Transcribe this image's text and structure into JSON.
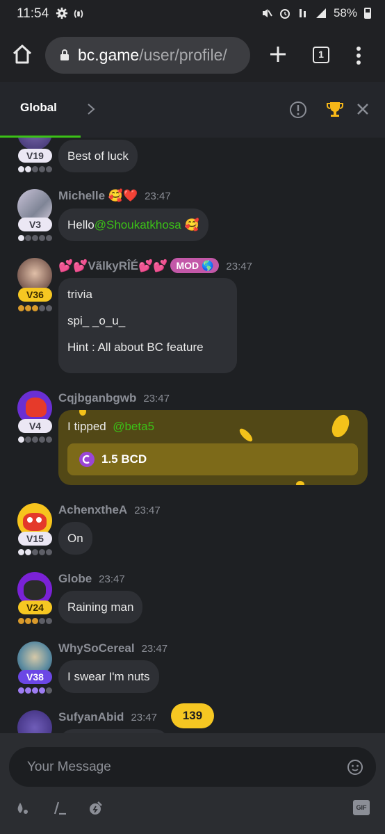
{
  "status_bar": {
    "time": "11:54",
    "battery": "58%",
    "icons": [
      "gear-icon",
      "nfc-icon",
      "mute-icon",
      "alarm-icon",
      "wifi-calling-icon",
      "signal-icon",
      "battery-icon"
    ]
  },
  "browser": {
    "url_host": "bc.game",
    "url_path": "/user/profile/",
    "tab_count": "1"
  },
  "chat_header": {
    "tab_label": "Global"
  },
  "messages": [
    {
      "user": "",
      "level": "V19",
      "text": "Best of luck"
    },
    {
      "user": "Michelle 🥰❤️",
      "time": "23:47",
      "level": "V3",
      "text_prefix": "Hello",
      "mention": "@Shoukatkhosa",
      "text_suffix": " 🥰"
    },
    {
      "user": "💕💕VãlkyRÎÉ💕💕",
      "mod_badge": "MOD 🌎",
      "time": "23:47",
      "level": "V36",
      "lines": [
        "trivia",
        "spi_ _o_u_",
        "Hint : All about BC feature"
      ]
    },
    {
      "user": "Cqjbganbgwb",
      "time": "23:47",
      "level": "V4",
      "tip_prefix": "I tipped",
      "tip_mention": "@beta5",
      "tip_amount": "1.5 BCD"
    },
    {
      "user": "AchenxtheA",
      "time": "23:47",
      "level": "V15",
      "text": "On"
    },
    {
      "user": "Globe",
      "time": "23:47",
      "level": "V24",
      "text": "Raining man"
    },
    {
      "user": "WhySoCereal",
      "time": "23:47",
      "level": "V38",
      "text": "I swear I'm nuts"
    },
    {
      "user": "SufyanAbid",
      "time": "23:47",
      "level": ""
    }
  ],
  "new_message_count": "139",
  "composer": {
    "placeholder": "Your Message",
    "tools": [
      "rain-icon",
      "slash-command-icon",
      "coin-drop-icon",
      "gif-icon"
    ],
    "gif_label": "GIF"
  },
  "colors": {
    "accent_green": "#3bc117",
    "level_gold": "#f6c722",
    "level_purple": "#6b47e5",
    "mod_pink": "#c358a8",
    "tip_card": "#524816"
  }
}
